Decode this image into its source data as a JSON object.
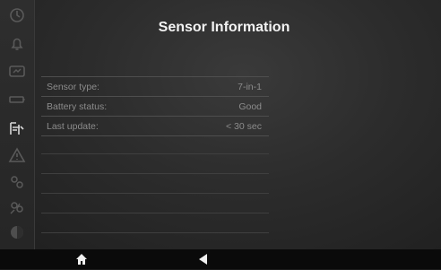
{
  "header": {
    "title": "Sensor Information"
  },
  "sensor_info": {
    "rows": [
      {
        "label": "Sensor type:",
        "value": "7-in-1"
      },
      {
        "label": "Battery status:",
        "value": "Good"
      },
      {
        "label": "Last update:",
        "value": "< 30 sec"
      }
    ]
  },
  "sidebar": {
    "icons": [
      "clock-icon",
      "bell-icon",
      "gauge-icon",
      "battery-icon",
      "sensor-icon",
      "warning-icon",
      "settings-icon",
      "people-icon",
      "theme-icon"
    ]
  },
  "bottom_bar": {
    "icons": [
      "home-icon",
      "back-icon"
    ]
  }
}
